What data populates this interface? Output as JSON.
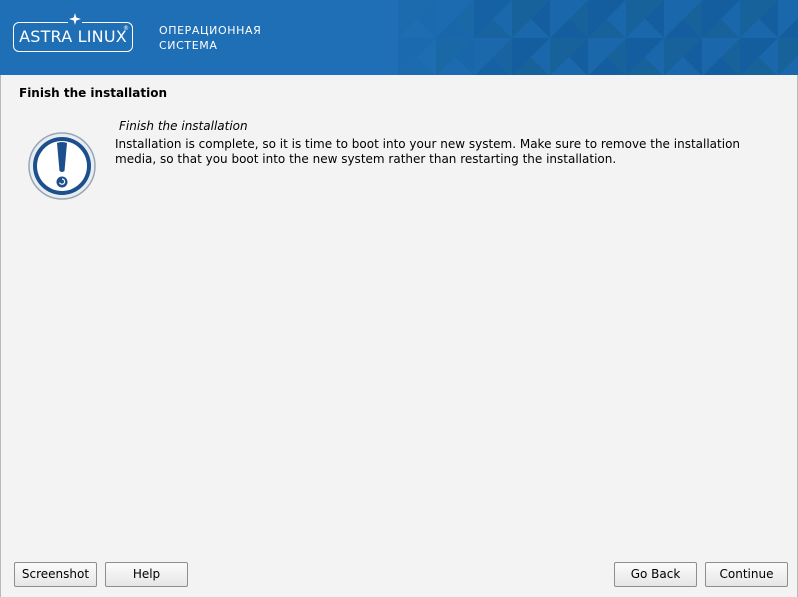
{
  "header": {
    "logo_text": "ASTRA LINUX",
    "logo_registered": "®",
    "caption_line1": "ОПЕРАЦИОННАЯ",
    "caption_line2": "СИСТЕМА",
    "colors": {
      "banner_base": "#1f72b8",
      "banner_light": "#3f95d6",
      "banner_dark": "#135c9c"
    }
  },
  "page": {
    "title": "Finish the installation"
  },
  "message": {
    "icon": "exclamation-icon",
    "heading": "Finish the installation",
    "body": "Installation is complete, so it is time to boot into your new system. Make sure to remove the installation media, so that you boot into the new system rather than restarting the installation."
  },
  "buttons": {
    "screenshot": "Screenshot",
    "help": "Help",
    "go_back": "Go Back",
    "continue": "Continue"
  }
}
